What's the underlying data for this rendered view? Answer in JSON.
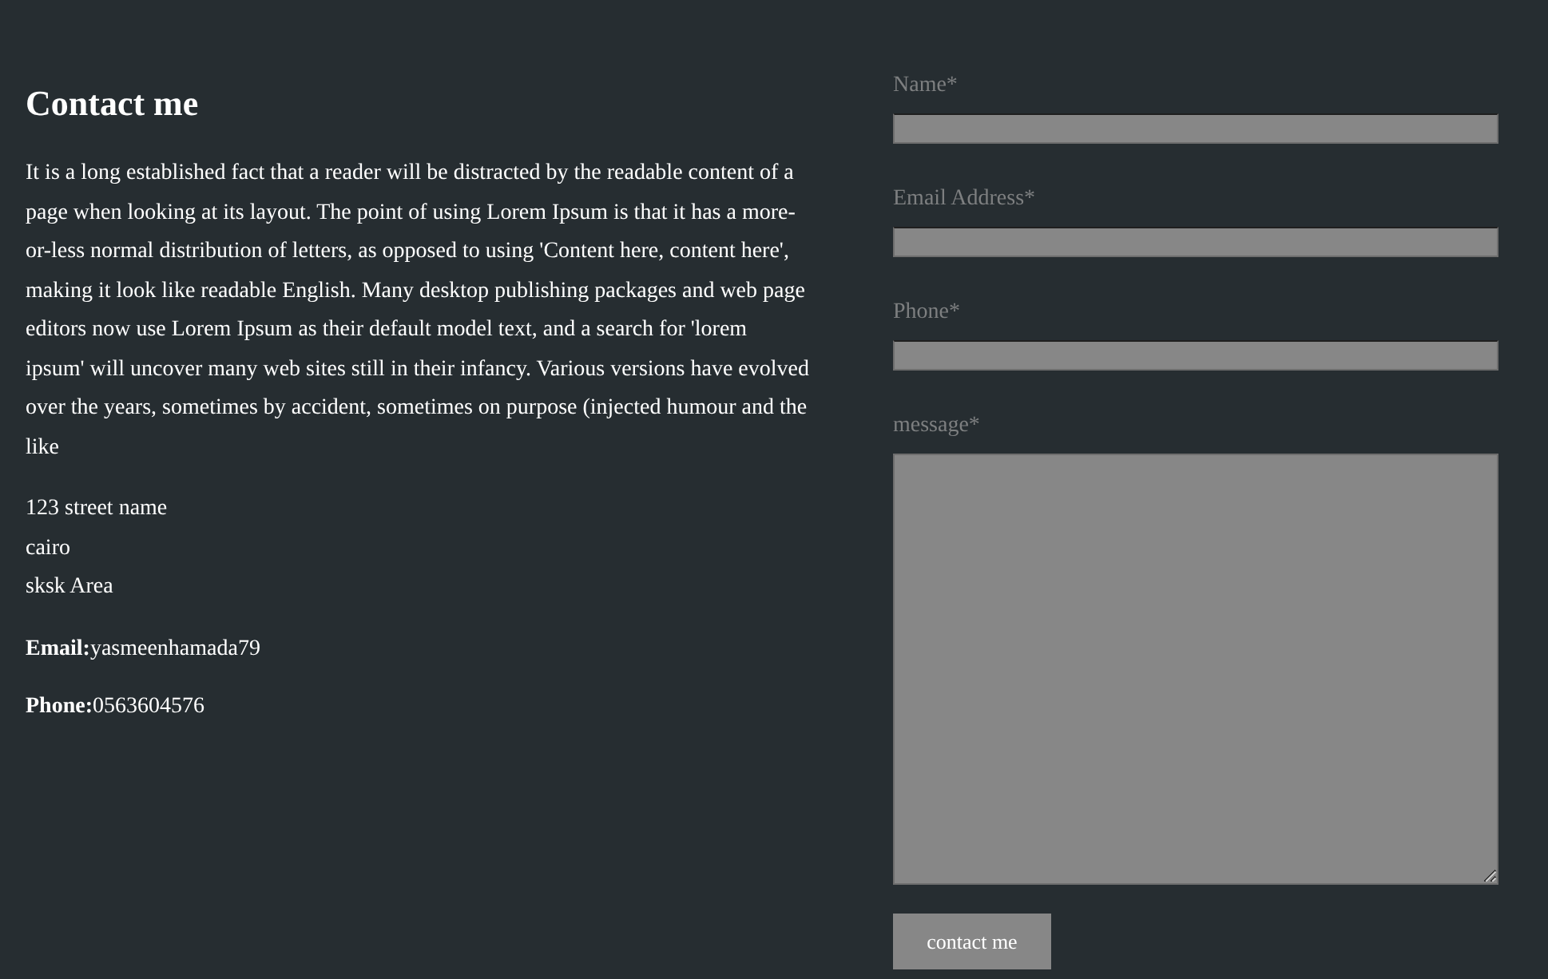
{
  "contact": {
    "title": "Contact me",
    "paragraph": "It is a long established fact that a reader will be distracted by the readable content of a page when looking at its layout. The point of using Lorem Ipsum is that it has a more-or-less normal distribution of letters, as opposed to using 'Content here, content here', making it look like readable English. Many desktop publishing packages and web page editors now use Lorem Ipsum as their default model text, and a search for 'lorem ipsum' will uncover many web sites still in their infancy. Various versions have evolved over the years, sometimes by accident, sometimes on purpose (injected humour and the like",
    "address": [
      "123 street name",
      "cairo",
      "sksk Area"
    ],
    "details": [
      "**Email:**yasmeenhamada79",
      "**Phone:**0563604576"
    ]
  },
  "form": {
    "fields": [
      {
        "label": "Name*",
        "kind": "input"
      },
      {
        "label": "Email Address*",
        "kind": "input"
      },
      {
        "label": "Phone*",
        "kind": "input"
      },
      {
        "label": "message*",
        "kind": "textarea"
      }
    ],
    "submit": "contact me"
  }
}
